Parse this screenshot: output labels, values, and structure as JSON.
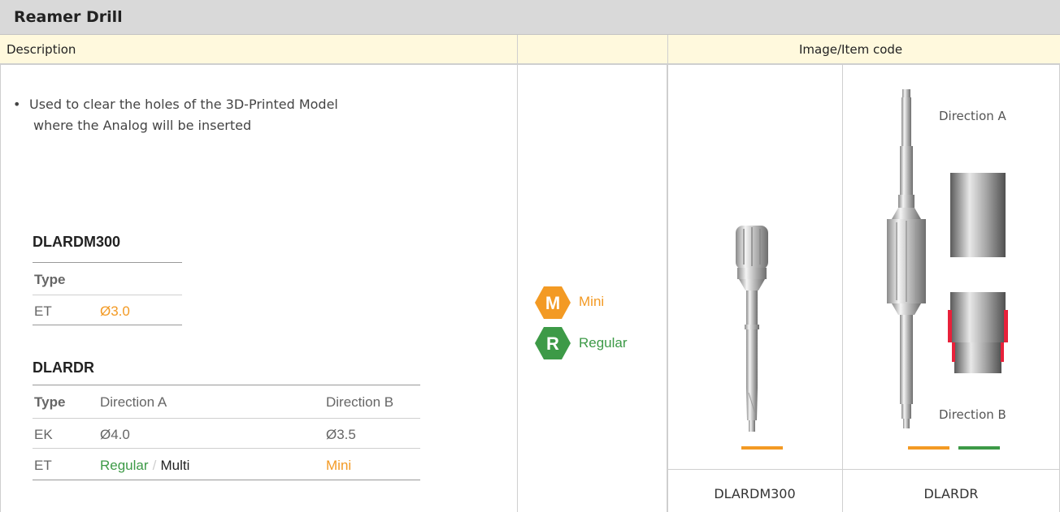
{
  "title": "Reamer Drill",
  "header": {
    "description_label": "Description",
    "image_label": "Image/Item code"
  },
  "description": {
    "bullet": "•",
    "line1": "Used to clear the holes of the 3D-Printed Model",
    "line2": "where the Analog will be inserted"
  },
  "table1": {
    "code": "DLARDM300",
    "type_header": "Type",
    "row": {
      "type": "ET",
      "value": "Ø3.0"
    }
  },
  "table2": {
    "code": "DLARDR",
    "headers": [
      "Type",
      "Direction A",
      "Direction B"
    ],
    "row1": {
      "type": "EK",
      "a": "Ø4.0",
      "b": "Ø3.5"
    },
    "row2": {
      "type": "ET",
      "a_regular": "Regular",
      "a_sep": "/",
      "a_multi": "Multi",
      "b": "Mini"
    }
  },
  "badges": [
    {
      "letter": "M",
      "label": "Mini",
      "color": "#f39a24"
    },
    {
      "letter": "R",
      "label": "Regular",
      "color": "#3d9a47"
    }
  ],
  "images": {
    "left_caption": "DLARDM300",
    "right_caption": "DLARDR",
    "direction_a": "Direction A",
    "direction_b": "Direction B"
  },
  "colors": {
    "orange": "#f39a24",
    "green": "#3d9a47",
    "red": "#e8213a",
    "header_bg": "#fff9dd",
    "title_bg": "#d9d9d9"
  },
  "icons": [
    "hexagon-mini-icon",
    "hexagon-regular-icon",
    "reamer-drill-image",
    "detail-direction-a-image",
    "detail-direction-b-image"
  ]
}
